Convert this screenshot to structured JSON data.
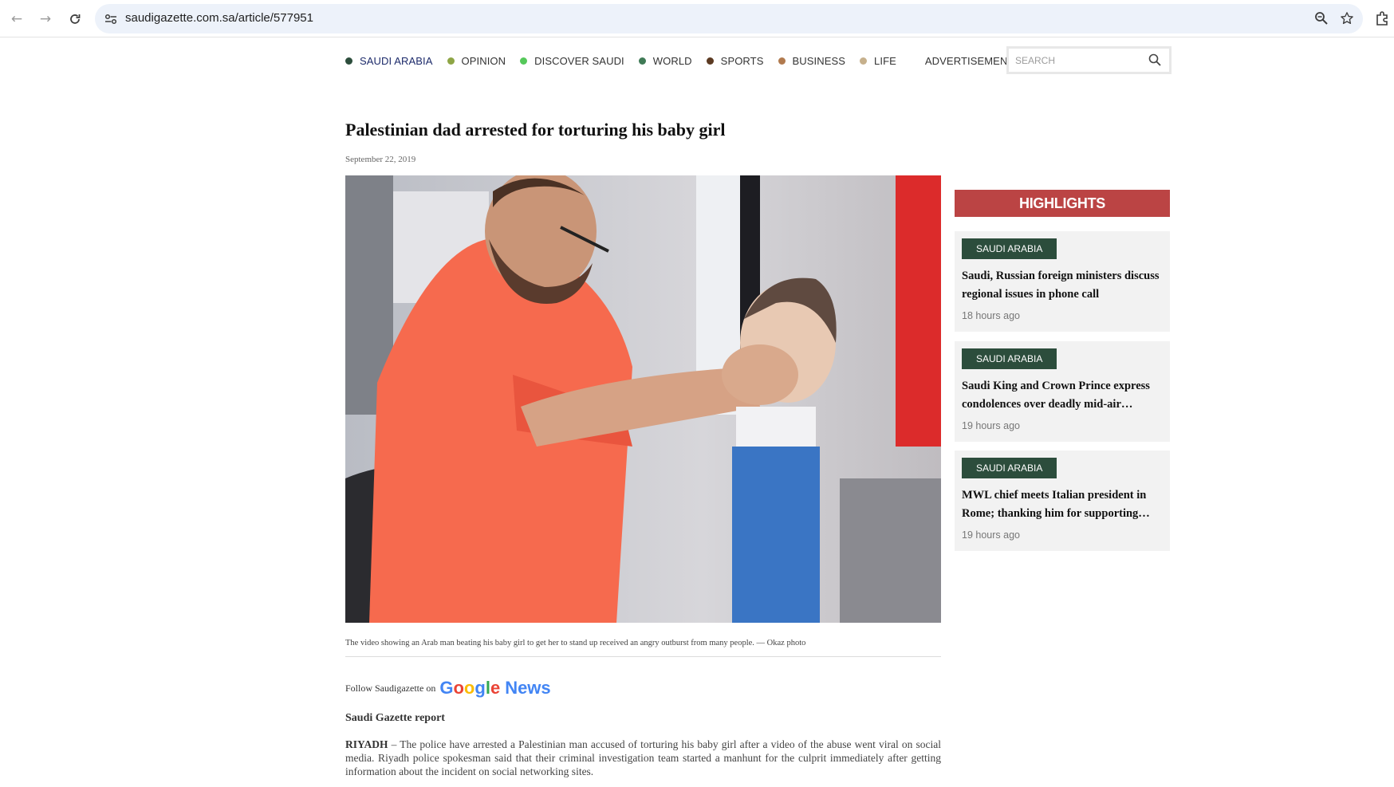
{
  "browser": {
    "url": "saudigazette.com.sa/article/577951"
  },
  "nav": {
    "items": [
      {
        "label": "SAUDI ARABIA",
        "dot_color": "#2c4d3c"
      },
      {
        "label": "OPINION",
        "dot_color": "#8ea545"
      },
      {
        "label": "DISCOVER SAUDI",
        "dot_color": "#55c85a"
      },
      {
        "label": "WORLD",
        "dot_color": "#3f7a56"
      },
      {
        "label": "SPORTS",
        "dot_color": "#5c3a22"
      },
      {
        "label": "BUSINESS",
        "dot_color": "#b17a4e"
      },
      {
        "label": "LIFE",
        "dot_color": "#c6b08c"
      },
      {
        "label": "ADVERTISEMENTS",
        "dot_color": ""
      }
    ],
    "search_placeholder": "SEARCH"
  },
  "article": {
    "headline": "Palestinian dad arrested for torturing his baby girl",
    "date": "September 22, 2019",
    "caption": "The video showing an Arab man beating his baby girl to get her to stand up received an angry outburst from many people. — Okaz photo",
    "follow_text": "Follow Saudigazette on",
    "google_word": "Google",
    "news_word": "News",
    "byline": "Saudi Gazette report",
    "dateline": "RIYADH",
    "body": " – The police have arrested a Palestinian man accused of torturing his baby girl after a video of the abuse went viral on social media. Riyadh police spokesman said that their criminal investigation team started a manhunt for the culprit immediately after getting information about the incident on social networking sites."
  },
  "sidebar": {
    "header": "HIGHLIGHTS",
    "cards": [
      {
        "tag": "SAUDI ARABIA",
        "title": "Saudi, Russian foreign ministers discuss regional issues in phone call",
        "time": "18 hours ago"
      },
      {
        "tag": "SAUDI ARABIA",
        "title": "Saudi King and Crown Prince express condolences over deadly mid-air…",
        "time": "19 hours ago"
      },
      {
        "tag": "SAUDI ARABIA",
        "title": "MWL chief meets Italian president in Rome; thanking him for supporting…",
        "time": "19 hours ago"
      }
    ]
  },
  "colors": {
    "highlight_red": "#bb4444",
    "tag_green": "#2c4d3c"
  }
}
